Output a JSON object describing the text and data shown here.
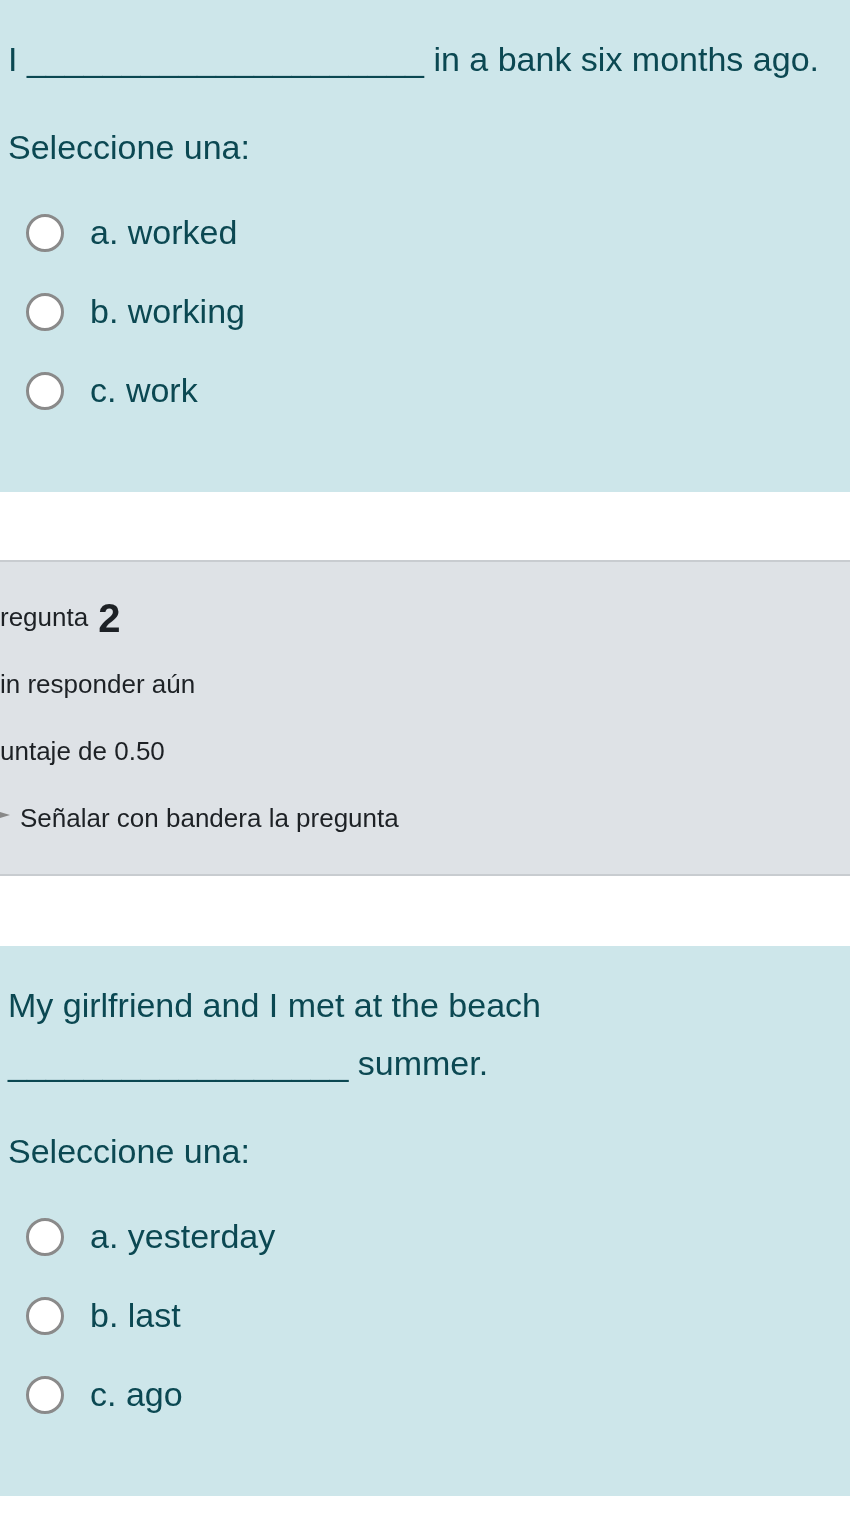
{
  "blocks": [
    {
      "kind": "question",
      "text": "I _____________________ in a bank six months ago.",
      "prompt": "Seleccione una:",
      "options": [
        {
          "label": "a. worked",
          "selected": false
        },
        {
          "label": "b. working",
          "selected": false
        },
        {
          "label": "c. work",
          "selected": false
        }
      ]
    },
    {
      "kind": "info",
      "title": "regunta",
      "number": "2",
      "status": "in responder aún",
      "marks": "untaje de 0.50",
      "flag_link": "Señalar con bandera la pregunta"
    },
    {
      "kind": "question",
      "text": "My girlfriend and I met at the beach __________________ summer.",
      "prompt": "Seleccione una:",
      "options": [
        {
          "label": "a. yesterday",
          "selected": false
        },
        {
          "label": "b. last",
          "selected": false
        },
        {
          "label": "c. ago",
          "selected": false
        }
      ]
    }
  ]
}
